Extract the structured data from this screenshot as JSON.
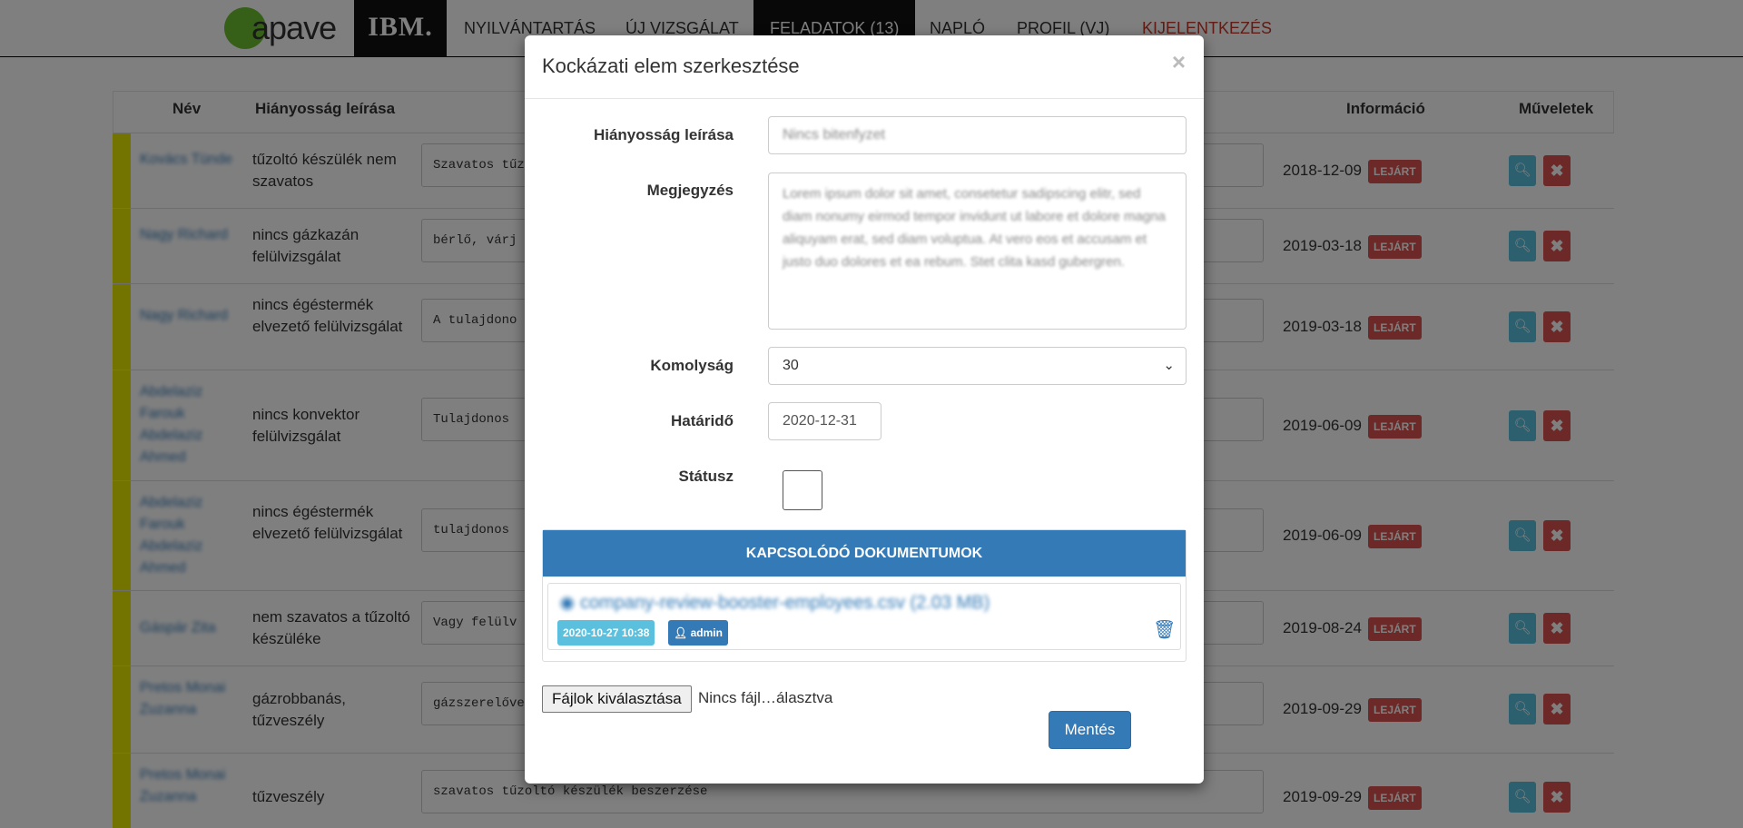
{
  "nav": {
    "logo_text": "apave",
    "ibm_text": "IBM.",
    "items": [
      "NYILVÁNTARTÁS",
      "ÚJ VIZSGÁLAT",
      "FELADATOK (13)",
      "NAPLÓ",
      "PROFIL (VJ)",
      "KIJELENTKEZÉS"
    ]
  },
  "table": {
    "headers": {
      "name": "Név",
      "desc": "Hiányosság leírása",
      "info": "Információ",
      "actions": "Műveletek"
    },
    "badge": "LEJÁRT",
    "rows": [
      {
        "name": "Kovács Tünde",
        "desc": "tűzoltó készülék nem szavatos",
        "note": "Szavatos tűz",
        "date": "2018-12-09"
      },
      {
        "name": "Nagy Richard",
        "desc": "nincs gázkazán felülvizsgálat",
        "note": "bérlő, várj",
        "date": "2019-03-18"
      },
      {
        "name": "Nagy Richard",
        "desc": "nincs égéstermék elvezető felülvizsgálat",
        "note": "A tulajdono",
        "date": "2019-03-18"
      },
      {
        "name": "Abdelaziz Farouk Abdelaziz Ahmed",
        "desc": "nincs konvektor felülvizsgálat",
        "note": "Tulajdonos",
        "date": "2019-06-09"
      },
      {
        "name": "Abdelaziz Farouk Abdelaziz Ahmed",
        "desc": "nincs égéstermék elvezető felülvizsgálat",
        "note": "tulajdonos",
        "date": "2019-06-09"
      },
      {
        "name": "Gáspár Zita",
        "desc": "nem szavatos a tűzoltó készüléke",
        "note": "Vagy felülv",
        "date": "2019-08-24"
      },
      {
        "name": "Pretos Monai Zuzanna",
        "desc": "gázrobbanás, tűzveszély",
        "note": "gázszerelőve",
        "date": "2019-09-29"
      },
      {
        "name": "Pretos Monai Zuzanna",
        "desc": "tűzveszély",
        "note": "szavatos tűzoltó készülék beszerzése",
        "date": "2019-09-29"
      }
    ]
  },
  "modal": {
    "title": "Kockázati elem szerkesztése",
    "close": "×",
    "desc_label": "Hiányosság leírása",
    "desc_value": "Nincs bitenfyzet",
    "note_label": "Megjegyzés",
    "note_value": "Lorem ipsum dolor sit amet, consetetur sadipscing elitr, sed diam nonumy eirmod tempor invidunt ut labore et dolore magna aliquyam erat, sed diam voluptua. At vero eos et accusam et justo duo dolores et ea rebum. Stet clita kasd gubergren.",
    "severity_label": "Komolyság",
    "severity_value": "30",
    "deadline_label": "Határidő",
    "deadline_value": "2020-12-31",
    "status_label": "Státusz",
    "docs_header": "KAPCSOLÓDÓ DOKUMENTUMOK",
    "file_name": "company-review-booster-employees.csv (2.03 MB)",
    "file_date": "2020-10-27 10:38",
    "file_user": "admin",
    "choose_files": "Fájlok kiválasztása",
    "no_file": "Nincs fájl…álasztva",
    "save": "Mentés"
  },
  "colors": {
    "primary": "#337ab7",
    "danger": "#d9534f",
    "info": "#5bc0de",
    "row_bar": "#e6e600"
  }
}
